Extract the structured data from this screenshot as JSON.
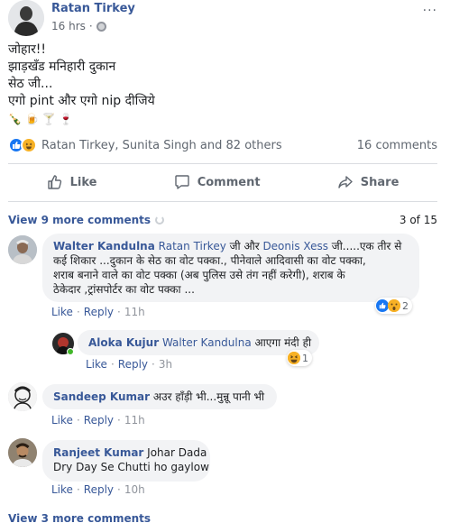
{
  "post": {
    "author": "Ratan Tirkey",
    "time": "16 hrs",
    "more": "···",
    "lines": [
      "जोहार!!",
      "झाड़खँड मनिहारी दुकान",
      "सेठ जी...",
      "एगो pint और एगो nip दीजिये"
    ],
    "emojis": [
      "🍾",
      "🍺",
      "🍸",
      "🍷"
    ]
  },
  "reactions": {
    "names": "Ratan Tirkey, Sunita Singh and 82 others",
    "comments_count": "16 comments"
  },
  "actions": {
    "like": "Like",
    "comment": "Comment",
    "share": "Share"
  },
  "comments_bar": {
    "view_more": "View 9 more comments",
    "pager": "3 of 15"
  },
  "comments": [
    {
      "name": "Walter Kandulna",
      "tag1": "Ratan Tirkey",
      "mid": " जी और ",
      "tag2": "Deonis Xess",
      "line1_rest": " जी.....एक तीर से",
      "line2": "कई शिकार ...दुकान के सेठ का वोट पक्का., पीनेवाले आदिवासी का वोट पक्का,",
      "line3": "शराब बनाने वाले का वोट पक्का (अब पुलिस उसे तंग नहीं करेगी), शराब के",
      "line4": "ठेकेदार ,ट्रांसपोर्टर का वोट पक्का ...",
      "like": "Like",
      "reply": "Reply",
      "time": "11h",
      "react_count": "2"
    },
    {
      "name": "Aloka Kujur",
      "tag": "Walter Kandulna",
      "text": " आएगा मंदी ही",
      "like": "Like",
      "reply": "Reply",
      "time": "3h",
      "react_count": "1"
    },
    {
      "name": "Sandeep Kumar",
      "text": " अउर हाँड़ी भी...मुन्नू पानी भी",
      "like": "Like",
      "reply": "Reply",
      "time": "11h"
    },
    {
      "name": "Ranjeet Kumar",
      "text1": " Johar Dada",
      "text2": "Dry Day Se Chutti ho gaylow",
      "like": "Like",
      "reply": "Reply",
      "time": "10h"
    }
  ],
  "footer": {
    "view_more": "View 3 more comments"
  }
}
